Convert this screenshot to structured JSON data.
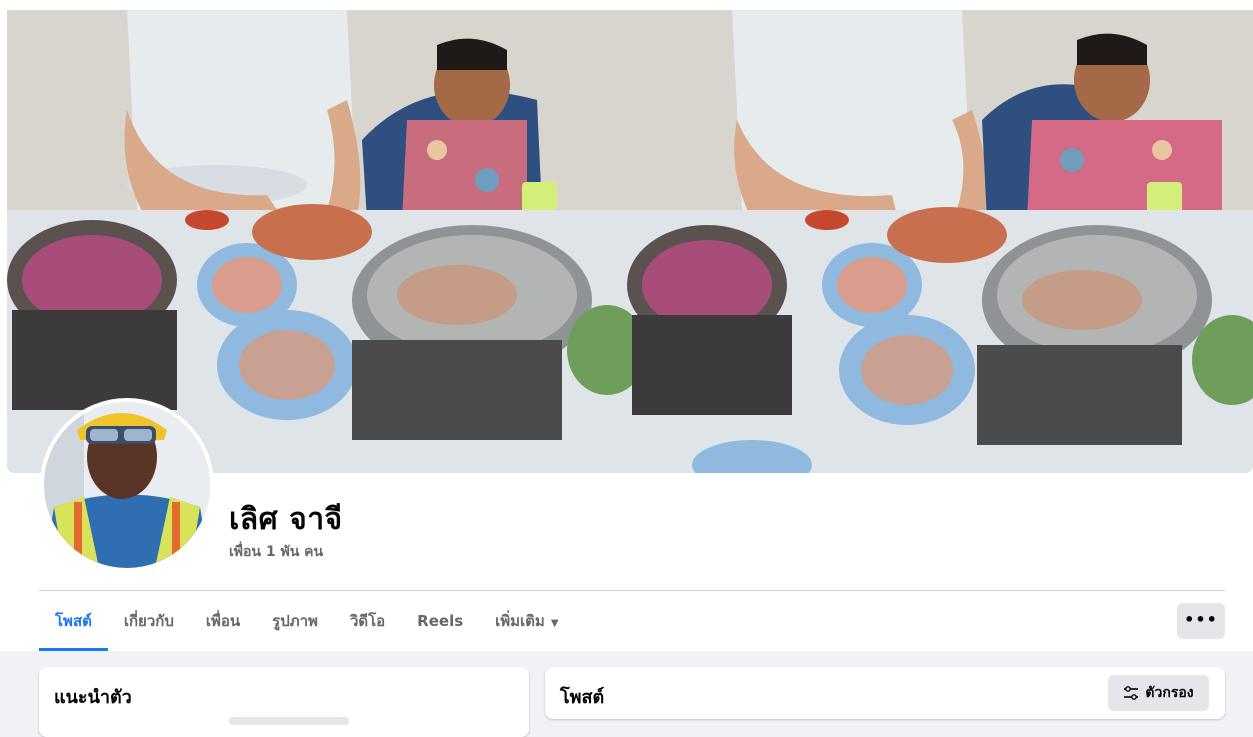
{
  "profile": {
    "name": "เลิศ จาจี",
    "friends": "เพื่อน 1 พัน คน"
  },
  "tabs": [
    {
      "label": "โพสต์",
      "active": true
    },
    {
      "label": "เกี่ยวกับ",
      "active": false
    },
    {
      "label": "เพื่อน",
      "active": false
    },
    {
      "label": "รูปภาพ",
      "active": false
    },
    {
      "label": "วิดีโอ",
      "active": false
    },
    {
      "label": "Reels",
      "active": false
    },
    {
      "label": "เพิ่มเติม",
      "active": false
    }
  ],
  "more_button": "•••",
  "intro": {
    "title": "แนะนำตัว"
  },
  "posts": {
    "title": "โพสต์",
    "filter_label": "ตัวกรอง"
  },
  "colors": {
    "accent": "#1877f2",
    "secondary_text": "#65676b",
    "button_bg": "#e4e6eb",
    "page_bg": "#f0f2f5"
  },
  "icons": [
    "more-dots-icon",
    "filter-sliders-icon",
    "dropdown-triangle-icon"
  ]
}
